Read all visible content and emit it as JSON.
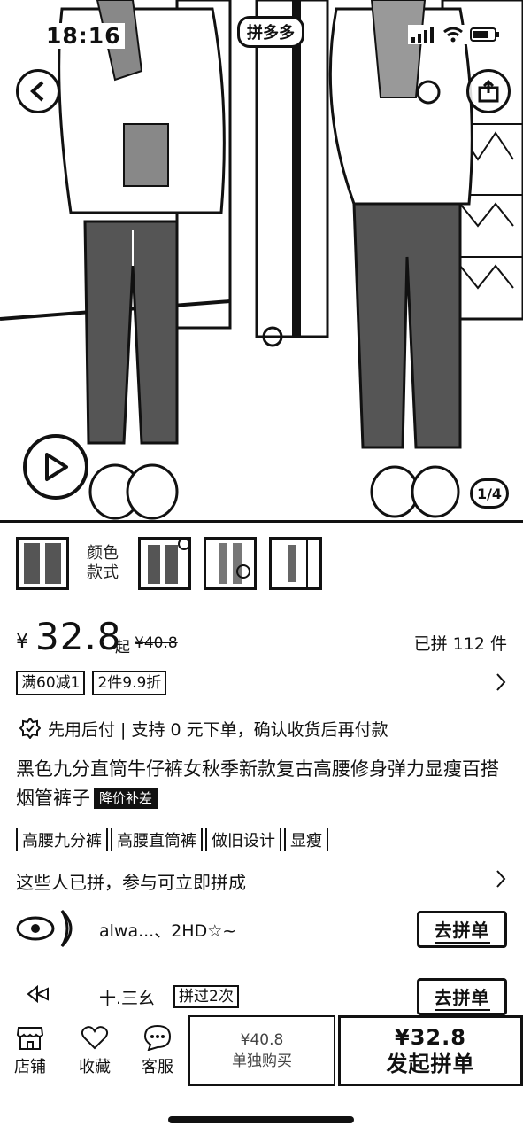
{
  "status_bar": {
    "time": "18:16"
  },
  "hero": {
    "tag": "拼多多",
    "counter": "1/4"
  },
  "variants": {
    "label_line1": "颜色",
    "label_line2": "款式"
  },
  "price": {
    "currency": "¥",
    "value": "32.8",
    "suffix": "起",
    "original": "¥40.8",
    "sold": "已拼 112 件"
  },
  "promos": [
    "满60减1",
    "2件9.9折"
  ],
  "payment": {
    "text": "先用后付 | 支持 0 元下单，确认收货后再付款"
  },
  "product": {
    "title": "黑色九分直筒牛仔裤女秋季新款复古高腰修身弹力显瘦百搭烟管裤子",
    "badge": "降价补差"
  },
  "attributes": [
    "高腰九分裤",
    "高腰直筒裤",
    "做旧设计",
    "显瘦"
  ],
  "groups": {
    "header": "这些人已拼，参与可立即拼成",
    "rows": [
      {
        "name": "alwa...、2HD☆~",
        "count": "",
        "button": "去拼单"
      },
      {
        "name": "十.三幺",
        "count": "拼过2次",
        "button": "去拼单"
      }
    ]
  },
  "bottom_bar": {
    "store": "店铺",
    "favorite": "收藏",
    "service": "客服",
    "single_price": "¥40.8",
    "single_label": "单独购买",
    "group_price": "¥32.8",
    "group_label": "发起拼单"
  }
}
